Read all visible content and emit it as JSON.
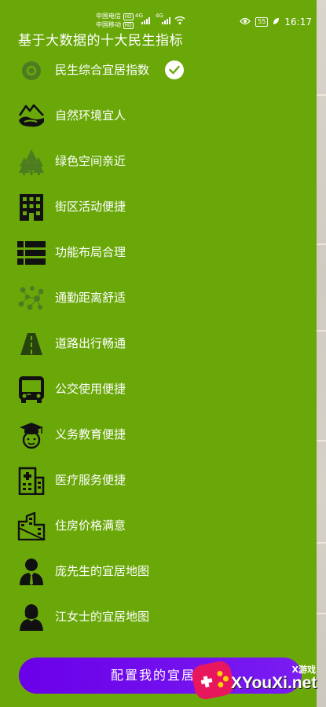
{
  "status_bar": {
    "carrier_1": "中国电信",
    "carrier_1_badge": "HD",
    "carrier_2": "中国移动",
    "carrier_2_badge": "HD",
    "network_1": "4G",
    "network_2": "4G",
    "battery": "55",
    "time": "16:17"
  },
  "drawer": {
    "title": "基于大数据的十大民生指标",
    "items": [
      {
        "label": "民生综合宜居指数",
        "icon": "index-circle-icon",
        "selected": true
      },
      {
        "label": "自然环境宜人",
        "icon": "mountain-lake-icon"
      },
      {
        "label": "绿色空间亲近",
        "icon": "forest-icon"
      },
      {
        "label": "街区活动便捷",
        "icon": "building-icon"
      },
      {
        "label": "功能布局合理",
        "icon": "list-layout-icon"
      },
      {
        "label": "通勤距离舒适",
        "icon": "network-dots-icon"
      },
      {
        "label": "道路出行畅通",
        "icon": "road-icon"
      },
      {
        "label": "公交使用便捷",
        "icon": "bus-icon"
      },
      {
        "label": "义务教育便捷",
        "icon": "graduate-icon"
      },
      {
        "label": "医疗服务便捷",
        "icon": "hospital-icon"
      },
      {
        "label": "住房价格满意",
        "icon": "housing-icon"
      },
      {
        "label": "庞先生的宜居地图",
        "icon": "man-avatar-icon"
      },
      {
        "label": "江女士的宜居地图",
        "icon": "woman-avatar-icon"
      }
    ],
    "cta_label": "配置我的宜居地"
  },
  "watermark": {
    "sub": "X游戏",
    "main": "XYouXi.net"
  },
  "colors": {
    "drawer_bg": "#6aa80a",
    "cta_bg": "#6a00e8",
    "icon_dark": "#111111",
    "icon_muted": "#4e7d20"
  }
}
